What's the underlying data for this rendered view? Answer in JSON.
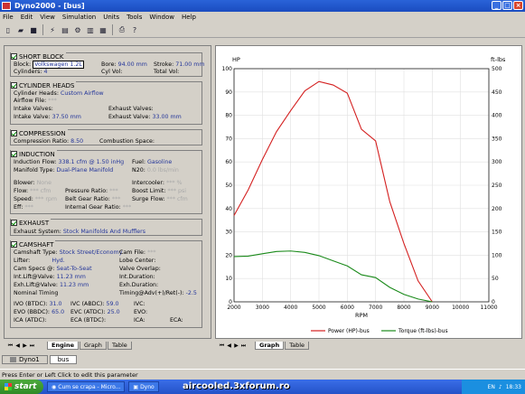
{
  "window": {
    "title": "Dyno2000 - [bus]",
    "buttons": [
      "_",
      "□",
      "×"
    ]
  },
  "menu": [
    "File",
    "Edit",
    "View",
    "Simulation",
    "Units",
    "Tools",
    "Window",
    "Help"
  ],
  "toolbar": [
    "new-icon",
    "open-icon",
    "save-icon",
    "run-icon",
    "compare-icon",
    "tools-icon",
    "print-icon",
    "help-icon"
  ],
  "short_block": {
    "header": "SHORT BLOCK",
    "block_label": "Block:",
    "block_value": "Volkswagen 1.2L",
    "bore_label": "Bore:",
    "bore_value": "94.00 mm",
    "stroke_label": "Stroke:",
    "stroke_value": "71.00 mm",
    "cyl_label": "Cylinders:",
    "cyl_value": "4",
    "cylvol_label": "Cyl Vol:",
    "totvol_label": "Total Vol:"
  },
  "cylinder_heads": {
    "header": "CYLINDER HEADS",
    "heads_label": "Cylinder Heads:",
    "heads_value": "Custom Airflow",
    "airflow_label": "Airflow File:",
    "airflow_value": "***",
    "iv_label": "Intake Valves:",
    "ev_label": "Exhaust Valves:",
    "ivd_label": "Intake Valve:",
    "ivd_value": "37.50 mm",
    "evd_label": "Exhaust Valve:",
    "evd_value": "33.00 mm"
  },
  "compression": {
    "header": "COMPRESSION",
    "ratio_label": "Compression Ratio:",
    "ratio_value": "8.50",
    "space_label": "Combustion Space:"
  },
  "induction": {
    "header": "INDUCTION",
    "flow_label": "Induction Flow:",
    "flow_value": "338.1 cfm  @  1.50 inHg",
    "fuel_label": "Fuel:",
    "fuel_value": "Gasoline",
    "manifold_label": "Manifold Type:",
    "manifold_value": "Dual-Plane Manifold",
    "n20_label": "N20:",
    "n20_value": "0.0 lbs/min",
    "blower_label": "Blower:",
    "blower_value": "None",
    "intercooler_label": "Intercooler:",
    "intercooler_value": "*** %",
    "bflow_label": "Flow:",
    "bflow_value": "*** cfm",
    "pratio_label": "Pressure Ratio:",
    "pratio_value": "***",
    "boost_label": "Boost Limit:",
    "boost_value": "*** psi",
    "speed_label": "Speed:",
    "speed_value": "*** rpm",
    "belt_label": "Belt Gear Ratio:",
    "belt_value": "***",
    "surge_label": "Surge Flow:",
    "surge_value": "*** cfm",
    "eff_label": "Eff:",
    "eff_value": "***",
    "igr_label": "Internal Gear Ratio:",
    "igr_value": "***"
  },
  "exhaust": {
    "header": "EXHAUST",
    "system_label": "Exhaust System:",
    "system_value": "Stock Manifolds And Mufflers"
  },
  "camshaft": {
    "header": "CAMSHAFT",
    "type_label": "Camshaft Type:",
    "type_value": "Stock Street/Economy",
    "file_label": "Cam File:",
    "file_value": "***",
    "lifter_label": "Lifter:",
    "lifter_value": "Hyd.",
    "lobe_label": "Lobe Center:",
    "specs_label": "Cam Specs @:",
    "specs_value": "Seat-To-Seat",
    "overlap_label": "Valve Overlap:",
    "intlift_label": "Int.Lift@Valve:",
    "intlift_value": "11.23 mm",
    "intdur_label": "Int.Duration:",
    "exhlift_label": "Exh.Lift@Valve:",
    "exhlift_value": "11.23 mm",
    "exhdur_label": "Exh.Duration:",
    "nominal_label": "Nominal Timing",
    "timing_label": "Timing@Adv(+)/Ret(-):",
    "timing_value": "-2.5",
    "ivo_label": "IVO (BTDC):",
    "ivo_value": "31.0",
    "ivc_label": "IVC (ABDC):",
    "ivc_value": "59.0",
    "ivc2_label": "IVC:",
    "evo_label": "EVO (BBDC):",
    "evo_value": "65.0",
    "evc_label": "EVC (ATDC):",
    "evc_value": "25.0",
    "evo2_label": "EVO:",
    "ica_label": "ICA (ATDC):",
    "eca_label": "ECA (BTDC):",
    "ica2_label": "ICA:",
    "eca2_label": "ECA:"
  },
  "left_tabs": [
    "Engine",
    "Graph",
    "Table"
  ],
  "right_tabs": [
    "Graph",
    "Table"
  ],
  "doc_tabs": [
    "Dyno1",
    "bus"
  ],
  "status": "Press Enter or Left Click to edit this parameter",
  "taskbar": {
    "start": "start",
    "items": [
      "Cum se crapa - Micro...",
      "Dyno"
    ],
    "lang": "EN",
    "time": "18:33"
  },
  "watermark": "aircooled.3xforum.ro",
  "chart_data": {
    "type": "line",
    "xlabel": "RPM",
    "ylabel_left": "HP",
    "ylabel_right": "ft-lbs",
    "xlim": [
      2000,
      11000
    ],
    "ylim_left": [
      0,
      100
    ],
    "ylim_right": [
      0,
      500
    ],
    "x_ticks": [
      2000,
      3000,
      4000,
      5000,
      6000,
      7000,
      8000,
      9000,
      10000,
      11000
    ],
    "y_ticks_left": [
      0,
      10,
      20,
      30,
      40,
      50,
      60,
      70,
      80,
      90,
      100
    ],
    "y_ticks_right": [
      0,
      50,
      100,
      150,
      200,
      250,
      300,
      350,
      400,
      450,
      500
    ],
    "grid": true,
    "legend_position": "bottom",
    "series": [
      {
        "name": "Power (HP)-bus",
        "color": "#d42020",
        "axis": "left",
        "x": [
          2000,
          2500,
          3000,
          3500,
          4000,
          4500,
          5000,
          5500,
          6000,
          6500,
          7000,
          7500,
          8000,
          8500,
          9000
        ],
        "values": [
          37,
          48,
          61,
          73,
          82,
          90.5,
          94.5,
          93,
          89.5,
          74,
          69,
          43,
          25,
          9,
          0
        ]
      },
      {
        "name": "Torque (ft-lbs)-bus",
        "color": "#1a8a1a",
        "axis": "right",
        "x": [
          2000,
          2500,
          3000,
          3500,
          4000,
          4500,
          5000,
          5500,
          6000,
          6500,
          7000,
          7500,
          8000,
          8500,
          9000
        ],
        "values": [
          97,
          98,
          103,
          108,
          109,
          106,
          99,
          88,
          77,
          58,
          52,
          31,
          16,
          6,
          0
        ]
      }
    ]
  }
}
